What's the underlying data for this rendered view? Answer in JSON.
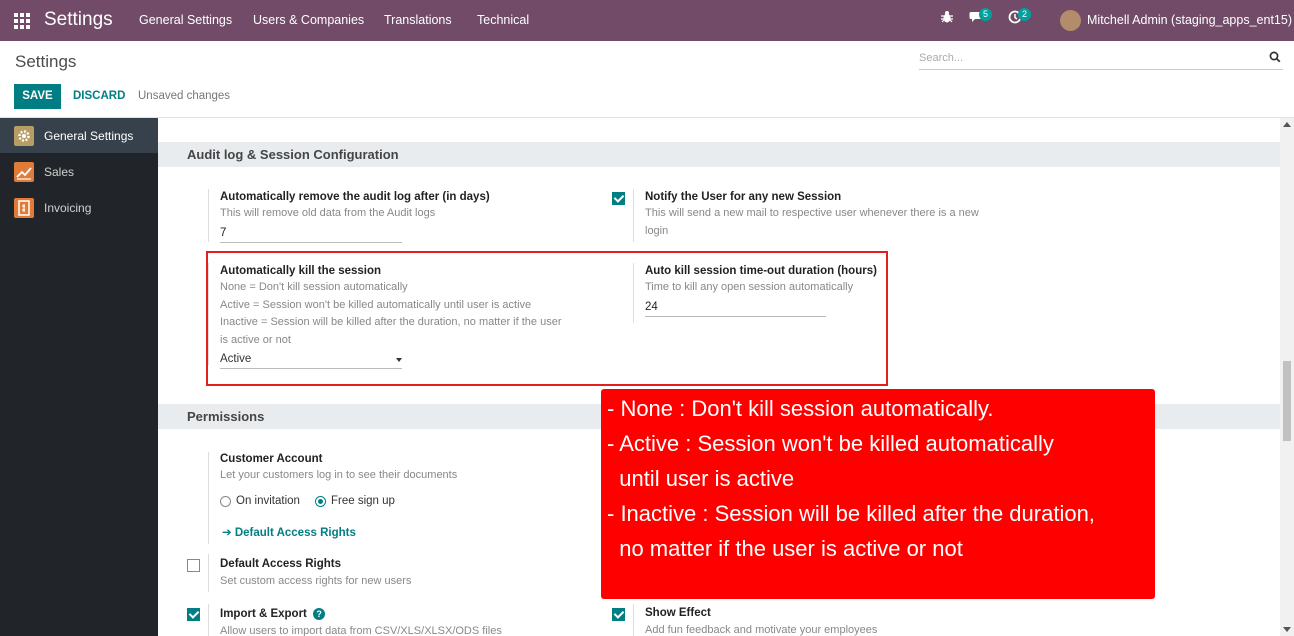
{
  "navbar": {
    "brand": "Settings",
    "menu": [
      "General Settings",
      "Users & Companies",
      "Translations",
      "Technical"
    ],
    "messages_badge": "5",
    "activities_badge": "2",
    "user": "Mitchell Admin (staging_apps_ent15)"
  },
  "control_panel": {
    "title": "Settings",
    "search_placeholder": "Search...",
    "save_label": "SAVE",
    "discard_label": "DISCARD",
    "unsaved_label": "Unsaved changes"
  },
  "sidebar": {
    "items": [
      {
        "label": "General Settings",
        "icon": "gear-icon",
        "color": "#b59d63",
        "active": true
      },
      {
        "label": "Sales",
        "icon": "chart-icon",
        "color": "#e07b39",
        "active": false
      },
      {
        "label": "Invoicing",
        "icon": "invoice-icon",
        "color": "#e07b39",
        "active": false
      }
    ]
  },
  "audit": {
    "heading": "Audit log & Session Configuration",
    "remove_log_title": "Automatically remove the audit log after (in days)",
    "remove_log_desc": "This will remove old data from the Audit logs",
    "remove_log_value": "7",
    "notify_title": "Notify the User for any new Session",
    "notify_desc_1": "This will send a new mail to respective user whenever there is a new",
    "notify_desc_2": "login",
    "notify_checked": true,
    "kill_title": "Automatically kill the session",
    "kill_desc_1": "None = Don't kill session automatically",
    "kill_desc_2": "Active = Session won't be killed automatically until user is active",
    "kill_desc_3": "Inactive = Session will be killed after the duration, no matter if the user",
    "kill_desc_4": "is active or not",
    "kill_value": "Active",
    "timeout_title": "Auto kill session time-out duration (hours)",
    "timeout_desc": "Time to kill any open session automatically",
    "timeout_value": "24"
  },
  "permissions": {
    "heading": "Permissions",
    "customer_title": "Customer Account",
    "customer_desc": "Let your customers log in to see their documents",
    "radio_invitation": "On invitation",
    "radio_signup": "Free sign up",
    "selected": "Free sign up",
    "default_access_link": "Default Access Rights",
    "default_access_title": "Default Access Rights",
    "default_access_desc": "Set custom access rights for new users",
    "import_title": "Import & Export",
    "import_desc": "Allow users to import data from CSV/XLS/XLSX/ODS files",
    "show_effect_title": "Show Effect",
    "show_effect_desc": "Add fun feedback and motivate your employees"
  },
  "callout": {
    "line1": "- None : Don't kill session automatically.",
    "line2": "- Active : Session won't be killed automatically",
    "line3": "  until user is active",
    "line4": "- Inactive : Session will be killed after the duration,",
    "line5": "  no matter if the user is active or not",
    "color": "#ff0000"
  }
}
